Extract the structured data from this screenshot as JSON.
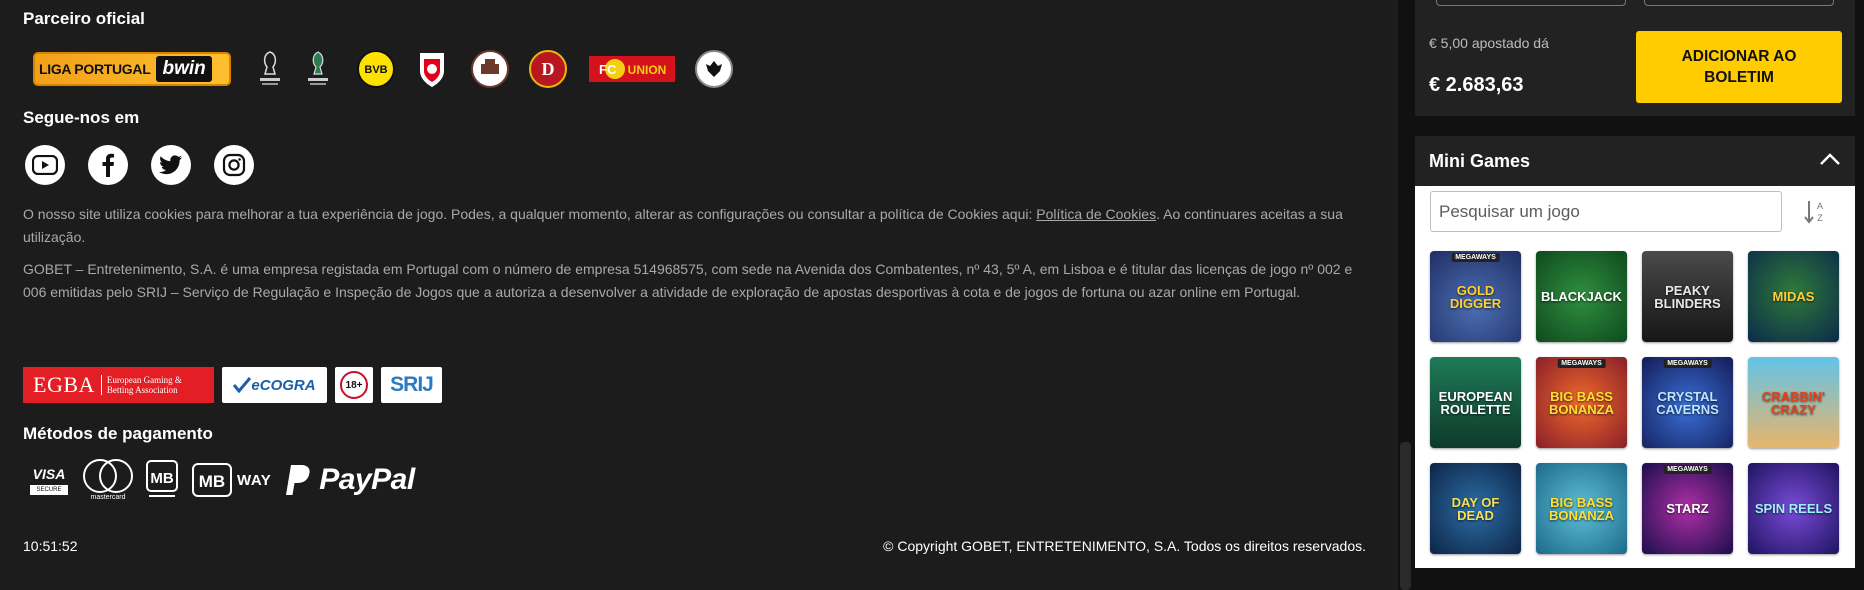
{
  "footer": {
    "partner_title": "Parceiro oficial",
    "liga_text": "LIGA PORTUGAL",
    "liga_brand": "bwin",
    "social_title": "Segue-nos em",
    "cookie_text": "O nosso site utiliza cookies para melhorar a tua experiência de jogo. Podes, a qualquer momento, alterar as configurações ou consultar a política de Cookies aqui: ",
    "cookie_link": "Política de Cookies",
    "cookie_text_end": ". Ao continuares aceitas a sua utilização.",
    "legal_text": "GOBET – Entretenimento, S.A. é uma empresa registada em Portugal com o número de empresa 514968575, com sede na Avenida dos Combatentes, nº 43, 5º A, em Lisboa e é titular das licenças de jogo nº 002 e 006 emitidas pelo SRIJ – Serviço de Regulação e Inspeção de Jogos que a autoriza a desenvolver a atividade de exploração de apostas desportivas à cota e de jogos de fortuna ou azar online em Portugal.",
    "egba_big": "EGBA",
    "egba_small_1": "European Gaming &",
    "egba_small_2": "Betting Association",
    "ecogra": "eCOGRA",
    "age": "18+",
    "srij": "SRIJ",
    "payments_title": "Métodos de pagamento",
    "visa": "VISA",
    "visa_secure": "SECURE",
    "mastercard": "mastercard",
    "mbway_way": "WAY",
    "paypal": "PayPal",
    "clock": "10:51:52",
    "copyright": "© Copyright GOBET, ENTRETENIMENTO, S.A. Todos os direitos reservados."
  },
  "betslip": {
    "stake_text": "€ 5,00 apostado dá",
    "return_value": "€ 2.683,63",
    "add_button": "ADICIONAR AO BOLETIM"
  },
  "minigames": {
    "title": "Mini Games",
    "search_placeholder": "Pesquisar um jogo",
    "games": [
      {
        "name": "GOLD DIGGER",
        "badge": "MEGAWAYS"
      },
      {
        "name": "BLACKJACK",
        "badge": ""
      },
      {
        "name": "PEAKY BLINDERS",
        "badge": ""
      },
      {
        "name": "MIDAS",
        "badge": ""
      },
      {
        "name": "EUROPEAN ROULETTE",
        "badge": ""
      },
      {
        "name": "BIG BASS BONANZA",
        "badge": "MEGAWAYS"
      },
      {
        "name": "CRYSTAL CAVERNS",
        "badge": "MEGAWAYS"
      },
      {
        "name": "CRABBIN' CRAZY",
        "badge": ""
      },
      {
        "name": "DAY OF DEAD",
        "badge": ""
      },
      {
        "name": "BIG BASS BONANZA",
        "badge": ""
      },
      {
        "name": "STARZ",
        "badge": "MEGAWAYS"
      },
      {
        "name": "SPIN REELS",
        "badge": ""
      }
    ]
  },
  "colors": {
    "accent": "#ffcc00",
    "footer_bg": "#1c1c1c",
    "panel_bg": "#222222"
  }
}
